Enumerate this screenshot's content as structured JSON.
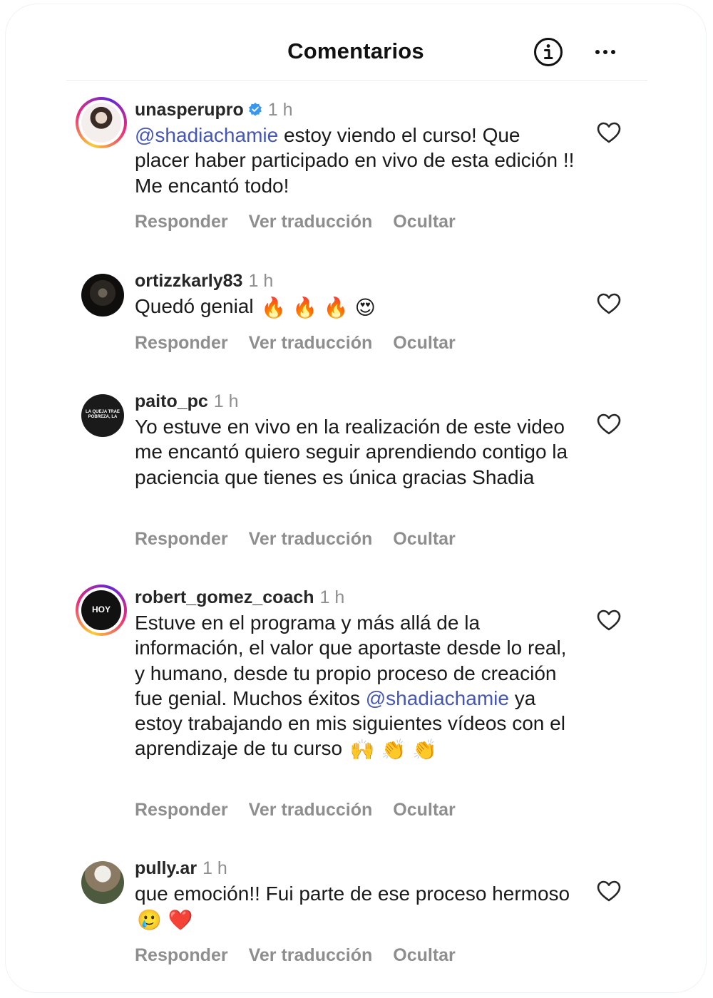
{
  "header": {
    "title": "Comentarios",
    "info_icon": "info-circle-icon",
    "more_icon": "more-horizontal-icon"
  },
  "actions": {
    "reply": "Responder",
    "translate": "Ver traducción",
    "hide": "Ocultar"
  },
  "comments": [
    {
      "username": "unasperupro",
      "verified": true,
      "time": "1 h",
      "mention": "@shadiachamie",
      "text": " estoy viendo el curso! Que placer haber participado en vivo de esta edición !! Me encantó todo!"
    },
    {
      "username": "ortizzkarly83",
      "time": "1 h",
      "text": "Quedó genial ",
      "emojis": "🔥 🔥 🔥 😍"
    },
    {
      "username": "paito_pc",
      "time": "1 h",
      "text": "Yo estuve en vivo en la realización de este video me encantó quiero seguir aprendiendo contigo la paciencia que tienes es única gracias Shadia",
      "avatar_text": "LA QUEJA TRAE POBREZA, LA"
    },
    {
      "username": "robert_gomez_coach",
      "time": "1 h",
      "text_before": "Estuve en el programa y más allá de la información, el valor que aportaste desde lo real, y humano, desde tu propio proceso de creación fue genial. Muchos éxitos ",
      "mention": "@shadiachamie",
      "text_after": " ya estoy trabajando en mis siguientes vídeos con el aprendizaje de tu curso ",
      "emojis": "🙌 👏 👏",
      "avatar_text": "HOY"
    },
    {
      "username": "pully.ar",
      "time": "1 h",
      "text": "que emoción!! Fui parte de ese proceso hermoso ",
      "emojis": "🥲 ❤️"
    }
  ],
  "colors": {
    "mention": "#4457b8",
    "muted": "#8e8e8e",
    "verified": "#3897f0"
  }
}
